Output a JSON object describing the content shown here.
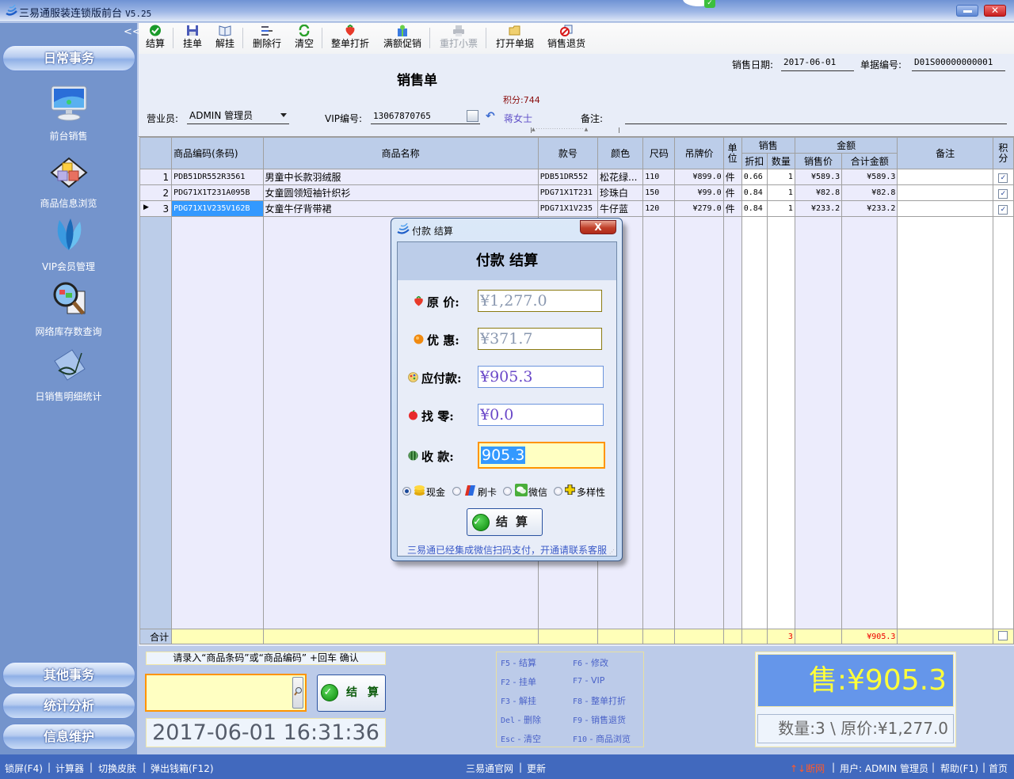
{
  "window": {
    "title": "三易通服装连锁版前台",
    "version": "V5.25",
    "minimize_label": "",
    "close_label": "✕"
  },
  "sidebar": {
    "collapse_label": "<<",
    "top_section": "日常事务",
    "items": [
      {
        "label": "前台销售",
        "icon": "monitor-icon"
      },
      {
        "label": "商品信息浏览",
        "icon": "cubes-icon"
      },
      {
        "label": "VIP会员管理",
        "icon": "petals-icon"
      },
      {
        "label": "网络库存数查询",
        "icon": "magnifier-icon"
      },
      {
        "label": "日销售明细统计",
        "icon": "notebook-icon"
      }
    ],
    "bottom_sections": [
      "其他事务",
      "统计分析",
      "信息维护"
    ]
  },
  "toolbar": {
    "buttons": [
      {
        "label": "结算",
        "icon": "check-icon",
        "enabled": true
      },
      {
        "label": "挂单",
        "icon": "save-icon",
        "enabled": true
      },
      {
        "label": "解挂",
        "icon": "book-icon",
        "enabled": true
      },
      {
        "label": "删除行",
        "icon": "delete-row-icon",
        "enabled": true
      },
      {
        "label": "清空",
        "icon": "refresh-icon",
        "enabled": true
      },
      {
        "label": "整单打折",
        "icon": "strawberry-icon",
        "enabled": true
      },
      {
        "label": "满额促销",
        "icon": "gift-icon",
        "enabled": true
      },
      {
        "label": "重打小票",
        "icon": "printer-icon",
        "enabled": false
      },
      {
        "label": "打开单据",
        "icon": "folder-icon",
        "enabled": true
      },
      {
        "label": "销售退货",
        "icon": "return-icon",
        "enabled": true
      }
    ]
  },
  "form": {
    "doc_title": "销售单",
    "sale_date_label": "销售日期:",
    "sale_date": "2017-06-01",
    "doc_no_label": "单据编号:",
    "doc_no": "D01S00000000001",
    "points_label": "积分:744",
    "salesperson_label": "营业员:",
    "salesperson": "ADMIN 管理员",
    "vip_label": "VIP编号:",
    "vip_no": "13067870765",
    "vip_name": "蒋女士",
    "remark_label": "备注:",
    "remark": ""
  },
  "grid": {
    "headers": {
      "code": "商品编码(条码)",
      "name": "商品名称",
      "style": "款号",
      "color": "颜色",
      "size": "尺码",
      "tag_price": "吊牌价",
      "unit": "单位",
      "sales_group": "销售",
      "discount": "折扣",
      "qty": "数量",
      "amount_group": "金额",
      "sale_price": "销售价",
      "total": "合计金额",
      "remark": "备注",
      "points": "积分"
    },
    "rows": [
      {
        "no": "1",
        "code": "PDB51DR552R3561",
        "name": "男童中长款羽绒服",
        "style": "PDB51DR552",
        "color": "松花绿...",
        "size": "110",
        "tag_price": "¥899.0",
        "unit": "件",
        "discount": "0.66",
        "qty": "1",
        "sale_price": "¥589.3",
        "total": "¥589.3",
        "remark": "",
        "points": true,
        "current": false
      },
      {
        "no": "2",
        "code": "PDG71X1T231A095B",
        "name": "女童圆领短袖针织衫",
        "style": "PDG71X1T231",
        "color": "珍珠白",
        "size": "150",
        "tag_price": "¥99.0",
        "unit": "件",
        "discount": "0.84",
        "qty": "1",
        "sale_price": "¥82.8",
        "total": "¥82.8",
        "remark": "",
        "points": true,
        "current": false
      },
      {
        "no": "3",
        "code": "PDG71X1V235V162B",
        "name": "女童牛仔背带裙",
        "style": "PDG71X1V235",
        "color": "牛仔蓝",
        "size": "120",
        "tag_price": "¥279.0",
        "unit": "件",
        "discount": "0.84",
        "qty": "1",
        "sale_price": "¥233.2",
        "total": "¥233.2",
        "remark": "",
        "points": true,
        "current": true
      }
    ],
    "total_row": {
      "label": "合计",
      "qty": "3",
      "total": "¥905.3",
      "points": false
    }
  },
  "bottom": {
    "scan_hint": "请录入“商品条码”或“商品编码” +回车 确认",
    "scan_value": "",
    "settle_label": "结 算",
    "clock": "2017-06-01 16:31:36",
    "shortcuts": [
      {
        "key": "F5",
        "label": "结算"
      },
      {
        "key": "F6",
        "label": "修改"
      },
      {
        "key": "F2",
        "label": "挂单"
      },
      {
        "key": "F7",
        "label": "VIP"
      },
      {
        "key": "F3",
        "label": "解挂"
      },
      {
        "key": "F8",
        "label": "整单打折"
      },
      {
        "key": "Del",
        "label": "删除"
      },
      {
        "key": "F9",
        "label": "销售退货"
      },
      {
        "key": "Esc",
        "label": "清空"
      },
      {
        "key": "F10",
        "label": "商品浏览"
      }
    ],
    "sale_total": "售:¥905.3",
    "qty_summary": "数量:3 \\ 原价:¥1,277.0"
  },
  "dialog": {
    "caption": "付款 结算",
    "close_label": "X",
    "heading": "付款  结算",
    "fields": [
      {
        "label": "原  价:",
        "value": "¥1,277.0",
        "icon": "strawberry-icon"
      },
      {
        "label": "优  惠:",
        "value": "¥371.7",
        "icon": "orange-icon"
      },
      {
        "label": "应付款:",
        "value": "¥905.3",
        "icon": "palette-icon"
      },
      {
        "label": "找   零:",
        "value": "¥0.0",
        "icon": "apple-icon"
      },
      {
        "label": "收   款:",
        "value": "905.3",
        "icon": "watermelon-icon"
      }
    ],
    "payment_methods": [
      {
        "label": "现金",
        "selected": true,
        "icon": "coins-icon"
      },
      {
        "label": "刷卡",
        "selected": false,
        "icon": "card-icon"
      },
      {
        "label": "微信",
        "selected": false,
        "icon": "wechat-icon"
      },
      {
        "label": "多样性",
        "selected": false,
        "icon": "plus-icon"
      }
    ],
    "settle_label": "结算",
    "note": "三易通已经集成微信扫码支付，开通请联系客服"
  },
  "statusbar": {
    "left": [
      "锁屏(F4)",
      "计算器",
      "切换皮肤",
      "弹出钱箱(F12)"
    ],
    "center": [
      "三易通官网",
      "更新"
    ],
    "network": "↑↓断网",
    "user": "用户: ADMIN 管理员",
    "help": "帮助(F1)",
    "home": "首页",
    "separator": "|"
  },
  "colors": {
    "sidebar_bg": "#7494cc",
    "header_bg": "#bccde9",
    "selection": "#3399ff",
    "total_row_bg": "#ffffb8",
    "sale_panel_bg": "#6596ea",
    "sale_panel_text": "#ffff3a",
    "statusbar_bg": "#4169be",
    "network_warning": "#ff5a2a",
    "points_text": "#8a0d0d"
  }
}
